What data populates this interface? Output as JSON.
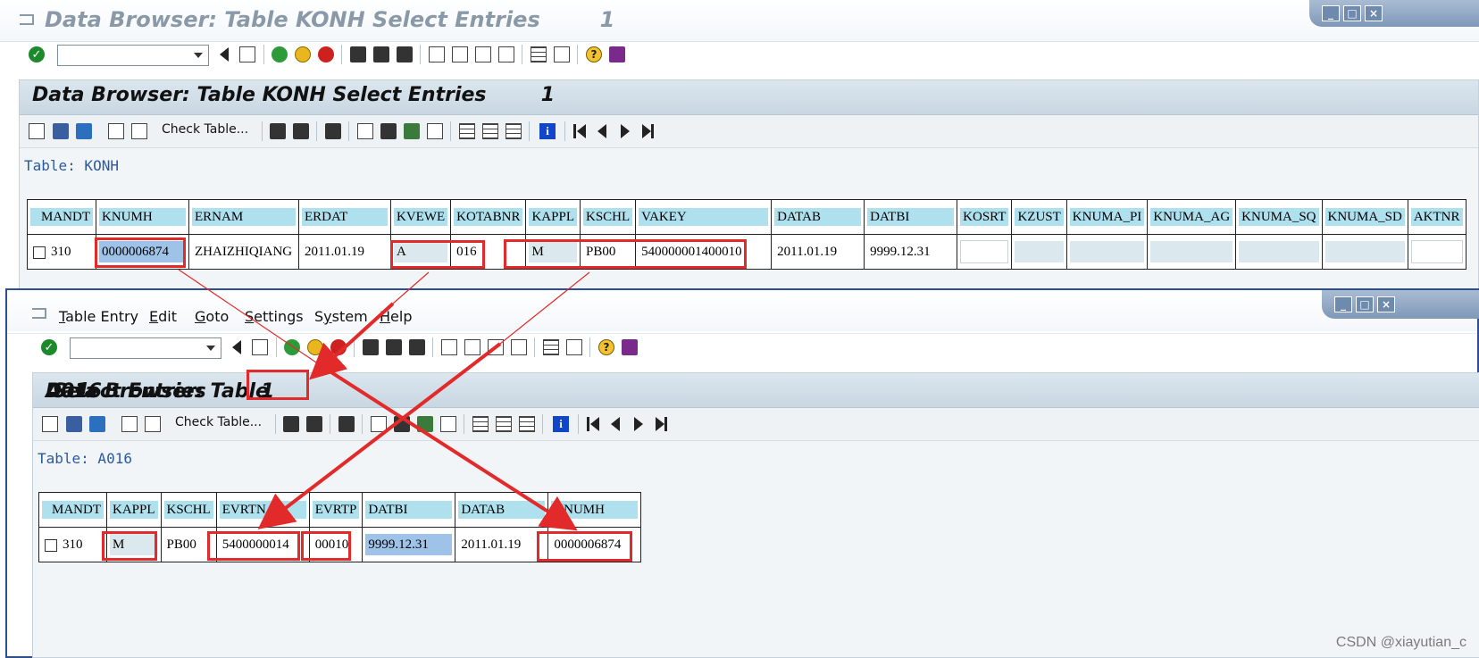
{
  "window1": {
    "title": "Data Browser: Table KONH Select Entries        1",
    "panel_title": "Data Browser: Table KONH Select Entries        1",
    "check_table_label": "Check Table...",
    "table_label": "Table: KONH",
    "columns": [
      "MANDT",
      "KNUMH",
      "ERNAM",
      "ERDAT",
      "KVEWE",
      "KOTABNR",
      "KAPPL",
      "KSCHL",
      "VAKEY",
      "DATAB",
      "DATBI",
      "KOSRT",
      "KZUST",
      "KNUMA_PI",
      "KNUMA_AG",
      "KNUMA_SQ",
      "KNUMA_SD",
      "AKTNR"
    ],
    "row": {
      "mandt": "310",
      "knumh": "0000006874",
      "ernam": "ZHAIZHIQIANG",
      "erdat": "2011.01.19",
      "kvewe": "A",
      "kotabnr": "016",
      "kappl": "M",
      "kschl": "PB00",
      "vakey": "540000001400010",
      "datab": "2011.01.19",
      "datbi": "9999.12.31"
    }
  },
  "window2": {
    "menu": [
      {
        "label": "Table Entry",
        "mnemonic": "T",
        "rest": "able Entry"
      },
      {
        "label": "Edit",
        "mnemonic": "E",
        "rest": "dit"
      },
      {
        "label": "Goto",
        "mnemonic": "G",
        "rest": "oto"
      },
      {
        "label": "Settings",
        "mnemonic": "S",
        "rest": "ettings"
      },
      {
        "label": "System",
        "mnemonic": "y",
        "pre": "S",
        "rest": "stem"
      },
      {
        "label": "Help",
        "mnemonic": "H",
        "rest": "elp"
      }
    ],
    "panel_title_prefix": "Data Browser: Table ",
    "panel_title_table": "A016",
    "panel_title_suffix": " Select Entries        1",
    "check_table_label": "Check Table...",
    "table_label": "Table: A016",
    "columns": [
      "MANDT",
      "KAPPL",
      "KSCHL",
      "EVRTN",
      "EVRTP",
      "DATBI",
      "DATAB",
      "KNUMH"
    ],
    "row": {
      "mandt": "310",
      "kappl": "M",
      "kschl": "PB00",
      "evrtn": "5400000014",
      "evrtp": "00010",
      "datbi": "9999.12.31",
      "datab": "2011.01.19",
      "knumh": "0000006874"
    }
  },
  "window_controls": {
    "minimize": "_",
    "maximize": "□",
    "close": "×"
  },
  "icons": [
    "enter-check-icon",
    "back-icon",
    "save-icon",
    "exit-icon",
    "cancel-icon",
    "print-icon",
    "find-icon",
    "find-next-icon",
    "first-page-icon",
    "prev-page-icon",
    "next-page-icon",
    "last-page-icon",
    "layout-icon",
    "help-icon",
    "info-icon"
  ],
  "watermark": "CSDN @xiayutian_c",
  "colors": {
    "header_field": "#aee0ee",
    "highlight": "#e32a2a",
    "selection": "#9fc2e8",
    "window_border": "#2b4f8f"
  }
}
